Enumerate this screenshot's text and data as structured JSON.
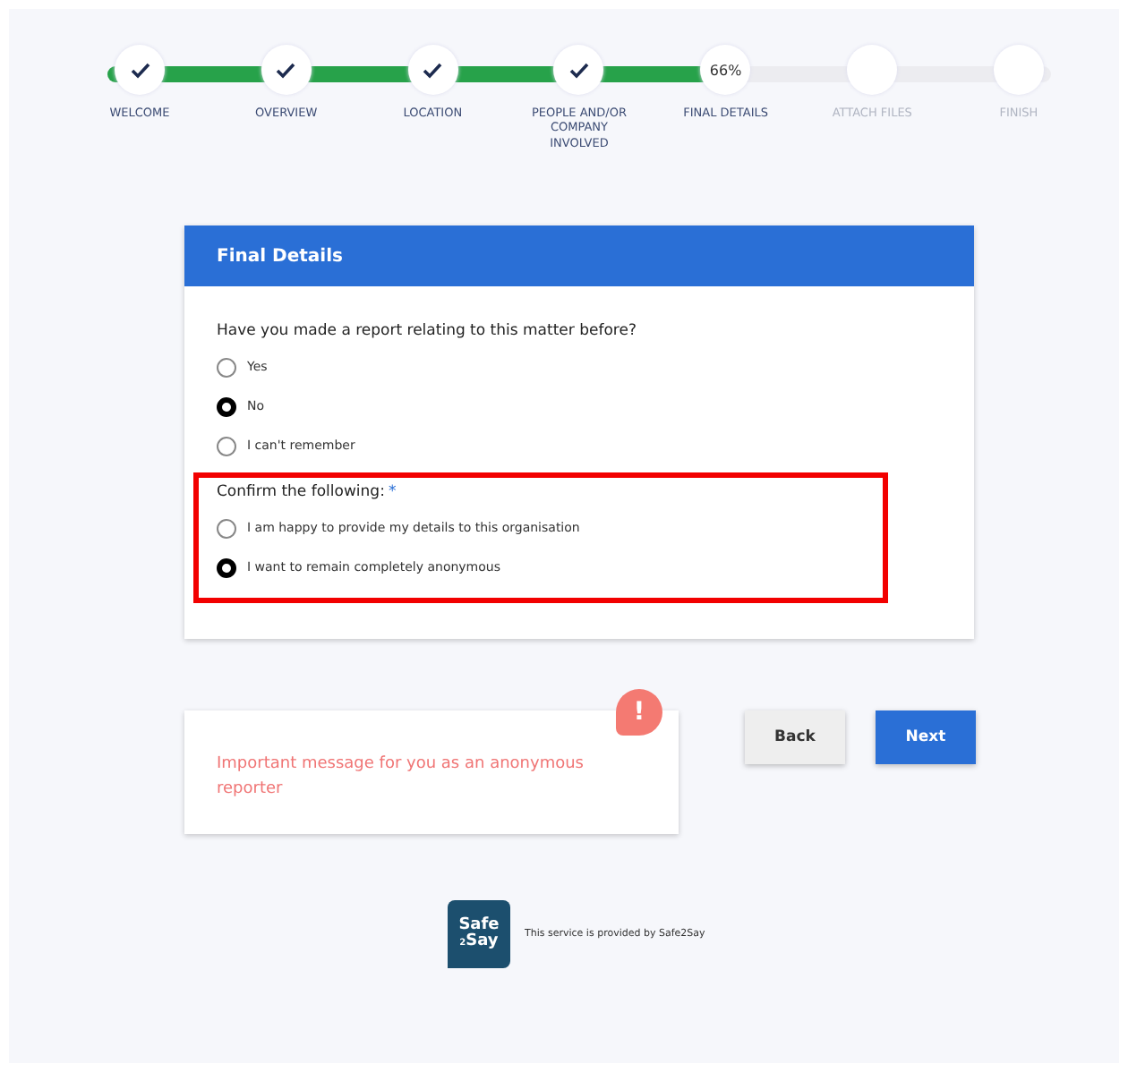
{
  "stepper": {
    "level": 0.66,
    "steps": [
      {
        "label": "WELCOME",
        "completed": true
      },
      {
        "label": "OVERVIEW",
        "completed": true
      },
      {
        "label": "LOCATION",
        "completed": true
      },
      {
        "label": "PEOPLE AND/OR COMPANY INVOLVED",
        "completed": true
      },
      {
        "label": "FINAL DETAILS",
        "completed": false,
        "badge": "66%"
      },
      {
        "label": "ATTACH FILES",
        "completed": false
      },
      {
        "label": "FINISH",
        "completed": false
      }
    ]
  },
  "card": {
    "title": "Final Details",
    "questions": [
      {
        "label": "Have you made a report relating to this matter before?",
        "required": false,
        "highlighted": false,
        "options": [
          {
            "label": "Yes",
            "selected": false
          },
          {
            "label": "No",
            "selected": true
          },
          {
            "label": "I can't remember",
            "selected": false
          }
        ]
      },
      {
        "label": "Confirm the following:",
        "required": true,
        "required_mark": "*",
        "highlighted": true,
        "options": [
          {
            "label": "I am happy to provide my details to this organisation",
            "selected": false
          },
          {
            "label": "I want to remain completely anonymous",
            "selected": true
          }
        ]
      }
    ]
  },
  "message": {
    "text": "Important message for you as an anonymous reporter",
    "badge": "!"
  },
  "buttons": [
    {
      "label": "Back",
      "kind": "secondary"
    },
    {
      "label": "Next",
      "kind": "primary"
    }
  ],
  "footer": {
    "logo": {
      "line1": "Safe",
      "mid": "2",
      "line2": "Say"
    },
    "text": "This service is provided by Safe2Say"
  }
}
